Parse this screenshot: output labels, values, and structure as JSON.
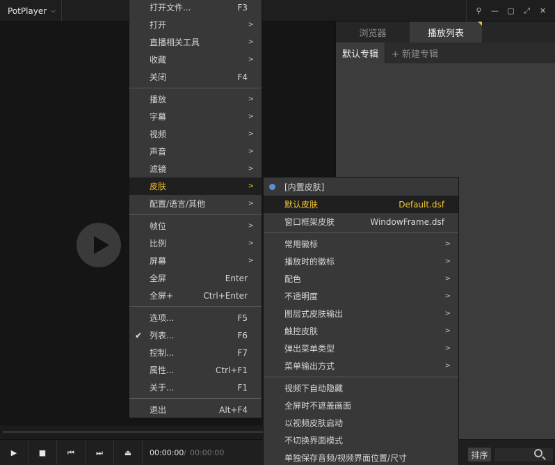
{
  "app": {
    "title": "PotPlayer"
  },
  "panel": {
    "tabs": [
      {
        "label": "浏览器"
      },
      {
        "label": "播放列表"
      }
    ],
    "subtabs": [
      {
        "label": "默认专辑"
      },
      {
        "label": "+ 新建专辑"
      }
    ],
    "sort_label": "排序"
  },
  "controls": {
    "time_current": "00:00:00",
    "time_separator": "/",
    "time_total": "00:00:00"
  },
  "main_menu": {
    "items": [
      {
        "label": "打开文件...",
        "shortcut": "F3"
      },
      {
        "label": "打开",
        "submenu": true
      },
      {
        "label": "直播相关工具",
        "submenu": true
      },
      {
        "label": "收藏",
        "submenu": true
      },
      {
        "label": "关闭",
        "shortcut": "F4"
      },
      {
        "label": "播放",
        "submenu": true
      },
      {
        "label": "字幕",
        "submenu": true
      },
      {
        "label": "视频",
        "submenu": true
      },
      {
        "label": "声音",
        "submenu": true
      },
      {
        "label": "滤镜",
        "submenu": true
      },
      {
        "label": "皮肤",
        "submenu": true
      },
      {
        "label": "配置/语言/其他",
        "submenu": true
      },
      {
        "label": "帧位",
        "submenu": true
      },
      {
        "label": "比例",
        "submenu": true
      },
      {
        "label": "屏幕",
        "submenu": true
      },
      {
        "label": "全屏",
        "shortcut": "Enter"
      },
      {
        "label": "全屏+",
        "shortcut": "Ctrl+Enter"
      },
      {
        "label": "选项...",
        "shortcut": "F5"
      },
      {
        "label": "列表...",
        "shortcut": "F6",
        "checked": true
      },
      {
        "label": "控制...",
        "shortcut": "F7"
      },
      {
        "label": "属性...",
        "shortcut": "Ctrl+F1"
      },
      {
        "label": "关于...",
        "shortcut": "F1"
      },
      {
        "label": "退出",
        "shortcut": "Alt+F4"
      }
    ]
  },
  "skin_menu": {
    "items": [
      {
        "label": "[内置皮肤]",
        "selected": true
      },
      {
        "label": "默认皮肤",
        "value": "Default.dsf"
      },
      {
        "label": "窗口框架皮肤",
        "value": "WindowFrame.dsf"
      },
      {
        "label": "常用徽标",
        "submenu": true
      },
      {
        "label": "播放时的徽标",
        "submenu": true
      },
      {
        "label": "配色",
        "submenu": true
      },
      {
        "label": "不透明度",
        "submenu": true
      },
      {
        "label": "图层式皮肤输出",
        "submenu": true
      },
      {
        "label": "触控皮肤",
        "submenu": true
      },
      {
        "label": "弹出菜单类型",
        "submenu": true
      },
      {
        "label": "菜单输出方式",
        "submenu": true
      },
      {
        "label": "视频下自动隐藏"
      },
      {
        "label": "全屏时不遮盖画面"
      },
      {
        "label": "以视频皮肤启动"
      },
      {
        "label": "不切换界面模式"
      },
      {
        "label": "单独保存音频/视频界面位置/尺寸"
      }
    ]
  },
  "icons": {
    "submenu_arrow": ">",
    "app_dropdown": "chevron-down-icon",
    "pin": "pin-icon",
    "minimize": "minimize-icon",
    "maximize": "maximize-icon",
    "fullscreen": "fullscreen-icon",
    "close": "close-icon",
    "play": "play-icon",
    "stop": "stop-icon",
    "prev": "previous-icon",
    "next": "next-icon",
    "eject": "eject-icon",
    "search": "search-icon"
  },
  "colors": {
    "highlight": "#f2c52c",
    "radio": "#5a8fd8"
  }
}
